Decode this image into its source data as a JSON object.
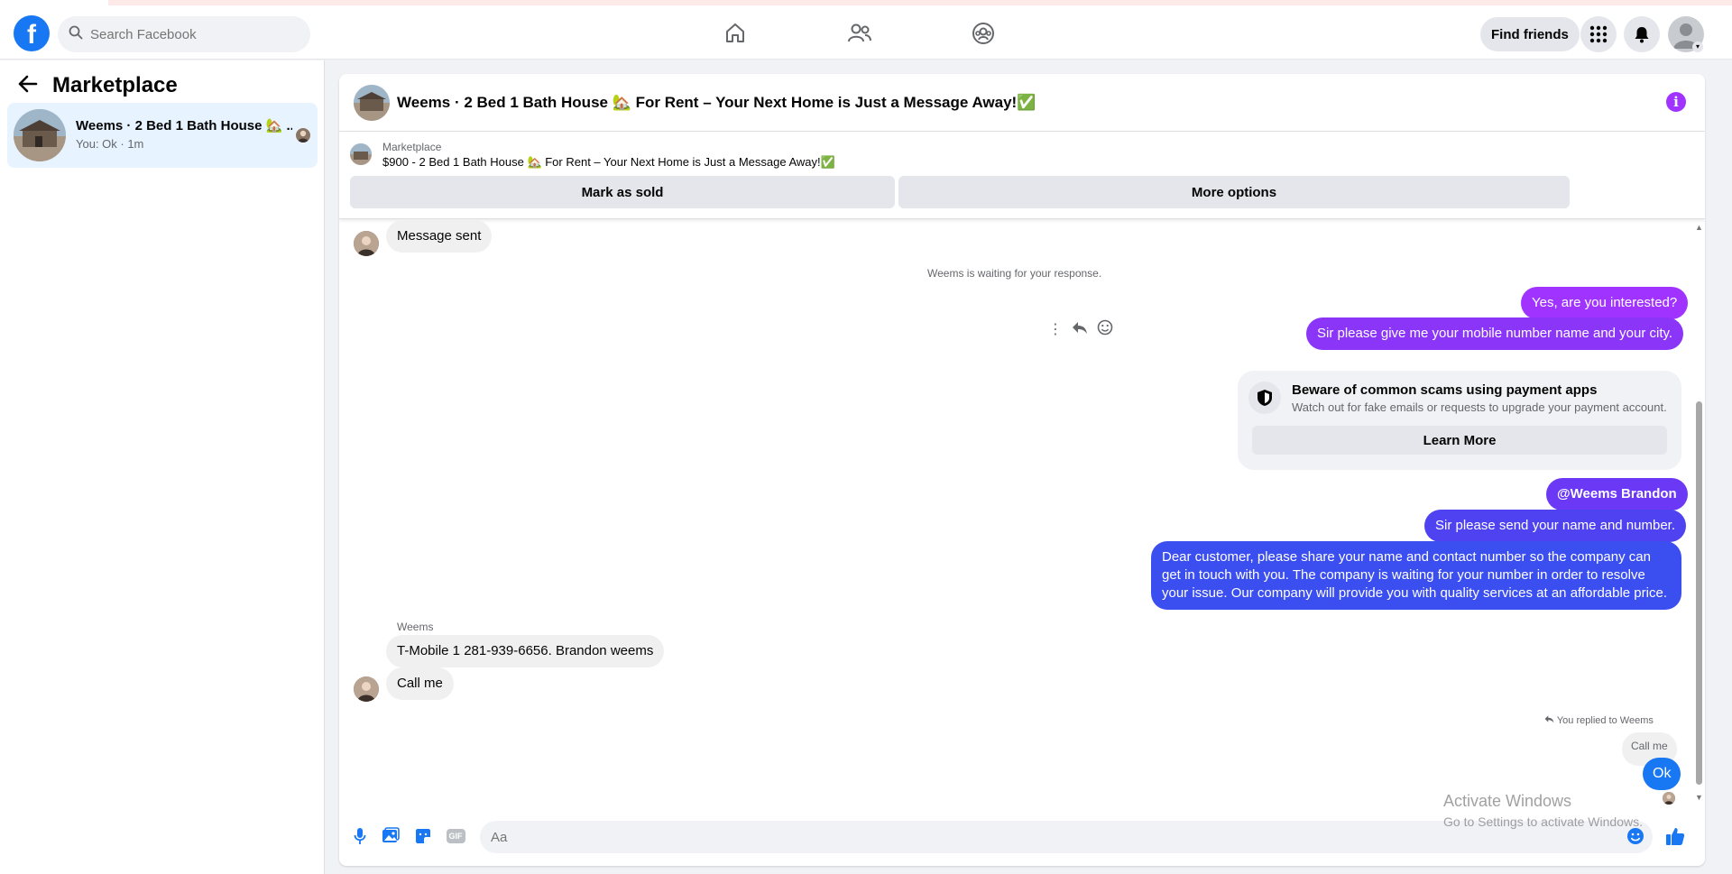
{
  "colors": {
    "brand": "#1877f2",
    "bubble_purple": "#a033ff",
    "bubble_indigo": "#6b38f5",
    "bubble_blue": "#4f42f0",
    "bubble_blue2": "#3b4ef0",
    "ok_blue": "#1877f2"
  },
  "header": {
    "logo": "f",
    "search_placeholder": "Search Facebook",
    "find_friends": "Find friends",
    "icons": [
      "home-icon",
      "friends-icon",
      "groups-icon",
      "menu-grid-icon",
      "bell-icon",
      "profile-avatar"
    ]
  },
  "sidebar": {
    "title": "Marketplace",
    "conversations": [
      {
        "title": "Weems · 2 Bed 1 Bath House 🏡 For Rent – Your Next Home is Just a Message Away!✅",
        "title_display": "Weems · 2 Bed 1 Bath House 🏡 ...",
        "subtitle": "You: Ok · 1m"
      }
    ]
  },
  "chat": {
    "title": "Weems · 2 Bed 1 Bath House 🏡 For Rent – Your Next Home is Just a Message Away!✅",
    "listing": {
      "kind": "Marketplace",
      "text": "$900 - 2 Bed 1 Bath House 🏡 For Rent – Your Next Home is Just a Message Away!✅",
      "mark_sold": "Mark as sold",
      "more_options": "More options"
    },
    "messages": {
      "message_sent": "Message sent",
      "waiting": "Weems is waiting for your response.",
      "out1": "Yes, are you interested?",
      "out2": "Sir please give me your mobile number name and your city.",
      "scam_title": "Beware of common scams using payment apps",
      "scam_sub": "Watch out for fake emails or requests to upgrade your payment account.",
      "learn_more": "Learn More",
      "out3": "@Weems Brandon",
      "out4": "Sir please send your name and number.",
      "out5": "Dear customer, please share your name and contact number so the company can get in touch with you. The company is waiting for your number in order to resolve your issue. Our company will provide you with quality services at an affordable price.",
      "sender_name": "Weems",
      "in1": "T-Mobile 1 281-939-6656. Brandon weems",
      "in2": "Call me",
      "replied_label": "You replied to Weems",
      "quoted": "Call me",
      "ok": "Ok"
    },
    "composer": {
      "placeholder": "Aa",
      "gif": "GIF"
    }
  },
  "watermark": {
    "line1": "Activate Windows",
    "line2": "Go to Settings to activate Windows."
  }
}
